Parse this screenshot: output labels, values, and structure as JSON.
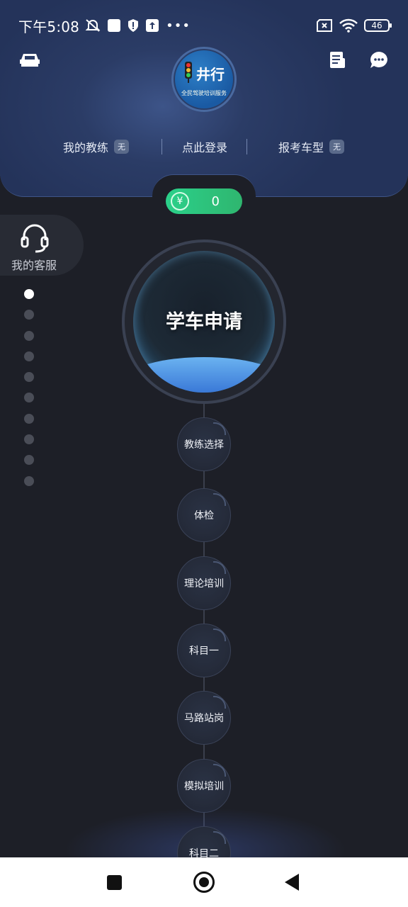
{
  "status_bar": {
    "time": "下午5:08",
    "battery": "46",
    "icons": [
      "mute-icon",
      "square-icon",
      "shield-icon",
      "upload-icon",
      "more-dots-icon",
      "sim-x-icon",
      "wifi-icon",
      "battery-icon"
    ]
  },
  "header": {
    "logo": {
      "name": "井行",
      "tagline": "全民驾驶培训服务"
    },
    "my_coach_label": "我的教练",
    "my_coach_value": "无",
    "login_label": "点此登录",
    "license_type_label": "报考车型",
    "license_type_value": "无"
  },
  "wallet": {
    "currency_icon": "¥",
    "amount": "0"
  },
  "service": {
    "label": "我的客服"
  },
  "pager": {
    "count": 10,
    "active_index": 0
  },
  "main_step": {
    "label": "学车申请"
  },
  "steps": [
    "教练选择",
    "体检",
    "理论培训",
    "科目一",
    "马路站岗",
    "模拟培训",
    "科目二"
  ],
  "colors": {
    "accent_green": "#2bd08a",
    "header_blue": "#2b3c66",
    "background": "#1d1f27"
  }
}
